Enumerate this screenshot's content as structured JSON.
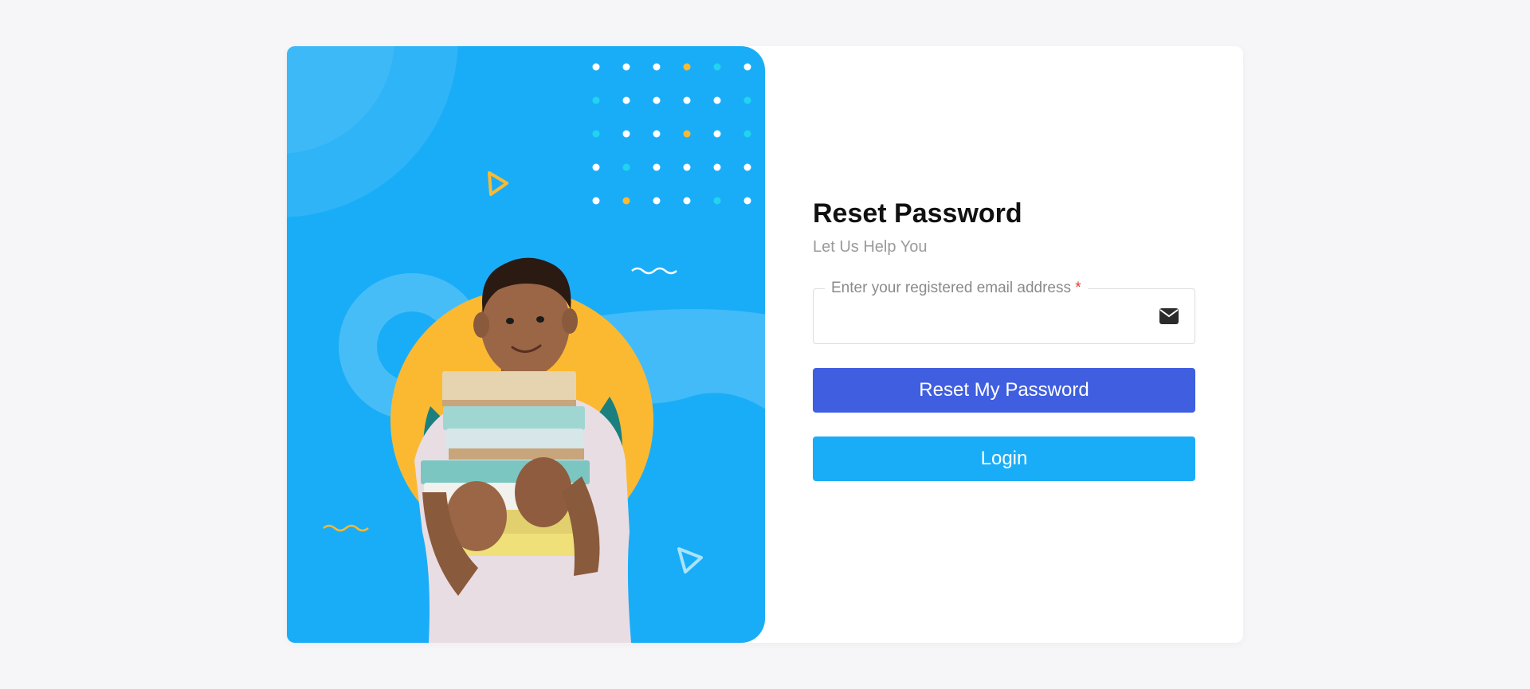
{
  "reset": {
    "title": "Reset Password",
    "subtitle": "Let Us Help You",
    "email_label": "Enter your registered email address",
    "required_mark": "*",
    "email_value": "",
    "email_icon": "envelope-icon",
    "reset_button_label": "Reset My Password",
    "login_button_label": "Login"
  },
  "hero": {
    "illustration": "student-holding-books",
    "decorations": [
      "dot-grid",
      "triangle-outline",
      "wave-line",
      "circle-shapes"
    ]
  },
  "colors": {
    "page_background": "#f6f6f8",
    "hero_background": "#1aadf7",
    "accent_yellow": "#fbb932",
    "reset_button": "#3f5ee0",
    "login_button": "#1aadf7",
    "required": "#e53935"
  }
}
